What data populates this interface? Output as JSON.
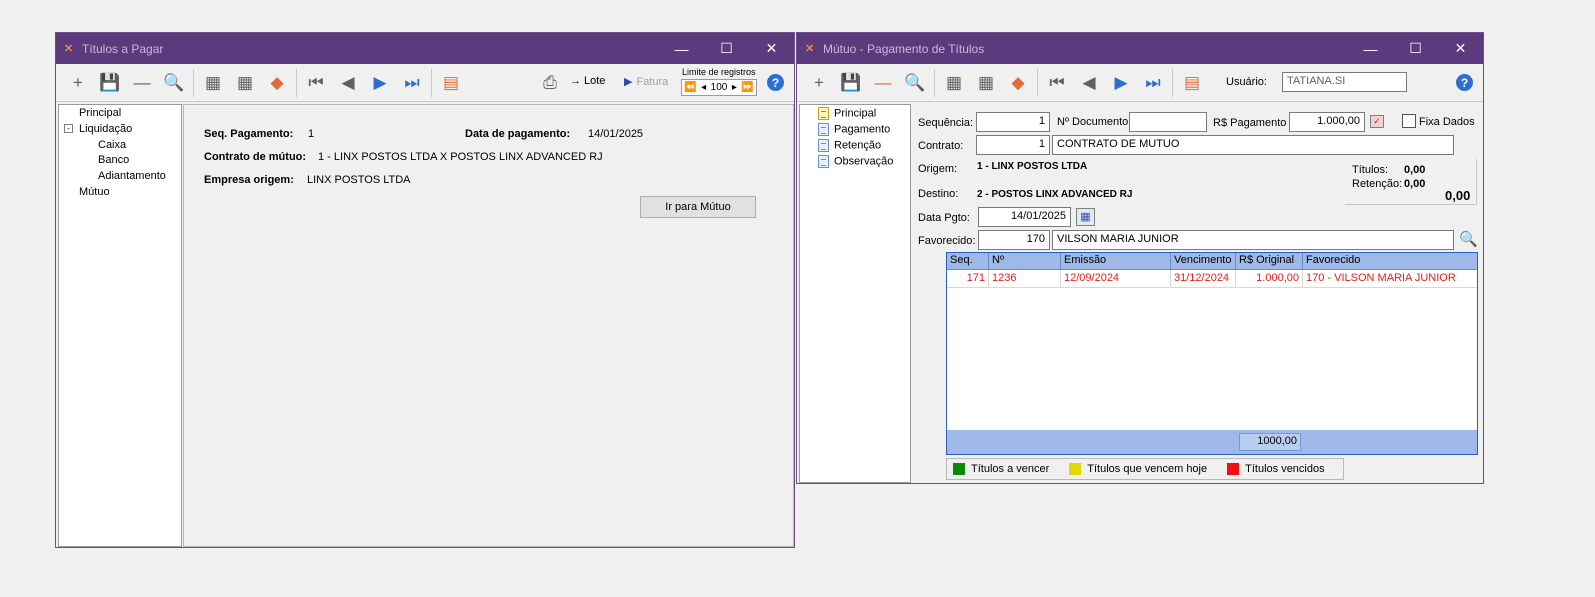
{
  "win1": {
    "title": "Títulos a Pagar",
    "toolbar": {
      "limit_label": "Limite de registros",
      "limit_value": "100",
      "lote_label": "Lote",
      "fatura_label": "Fatura"
    },
    "tree": {
      "principal": "Principal",
      "liquidacao": "Liquidação",
      "caixa": "Caixa",
      "banco": "Banco",
      "adiantamento": "Adiantamento",
      "mutuo": "Mútuo"
    },
    "fields": {
      "seq_label": "Seq. Pagamento:",
      "seq_value": "1",
      "data_label": "Data de pagamento:",
      "data_value": "14/01/2025",
      "contrato_label": "Contrato de mútuo:",
      "contrato_value": "1 - LINX POSTOS LTDA X POSTOS LINX ADVANCED RJ",
      "empresa_label": "Empresa origem:",
      "empresa_value": "LINX POSTOS LTDA",
      "ir_button": "Ir para Mútuo"
    }
  },
  "win2": {
    "title": "Mútuo - Pagamento de Títulos",
    "toolbar": {
      "usuario_label": "Usuário:",
      "usuario_value": "TATIANA.SI"
    },
    "tree": {
      "principal": "Principal",
      "pagamento": "Pagamento",
      "retencao": "Retenção",
      "observacao": "Observação"
    },
    "form": {
      "sequencia_label": "Sequência:",
      "sequencia_value": "1",
      "ndoc_label": "Nº Documento",
      "ndoc_value": "",
      "rs_pag_label": "R$ Pagamento",
      "rs_pag_value": "1.000,00",
      "fixa_label": "Fixa Dados",
      "contrato_label": "Contrato:",
      "contrato_num": "1",
      "contrato_desc": "CONTRATO DE MUTUO",
      "origem_label": "Origem:",
      "origem_value": "1 - LINX POSTOS LTDA",
      "destino_label": "Destino:",
      "destino_value": "2 - POSTOS LINX ADVANCED RJ",
      "data_pgto_label": "Data Pgto:",
      "data_pgto_value": "14/01/2025",
      "favorecido_label": "Favorecido:",
      "favorecido_num": "170",
      "favorecido_name": "VILSON MARIA JUNIOR"
    },
    "summary": {
      "titulos_label": "Títulos:",
      "titulos_value": "0,00",
      "retencao_label": "Retenção:",
      "retencao_value": "0,00",
      "total": "0,00"
    },
    "grid": {
      "headers": [
        "Seq.",
        "Nº",
        "Emissão",
        "Vencimento",
        "R$ Original",
        "Favorecido"
      ],
      "rows": [
        [
          "171",
          "1236",
          "12/09/2024",
          "31/12/2024",
          "1.000,00",
          "170 - VILSON MARIA JUNIOR"
        ]
      ],
      "total": "1000,00"
    },
    "legend": {
      "a_vencer": "Títulos a vencer",
      "vencem_hoje": "Títulos que vencem hoje",
      "vencidos": "Títulos vencidos",
      "colors": {
        "a_vencer": "#0a8a0a",
        "vencem_hoje": "#e0d800",
        "vencidos": "#f01010"
      }
    }
  }
}
